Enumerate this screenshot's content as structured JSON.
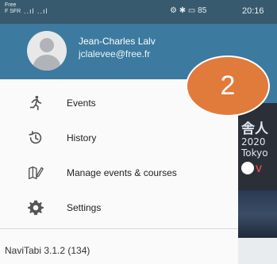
{
  "status_bar": {
    "carrier": "Free\nF SFR",
    "signal": "..ıl ..ıl",
    "icons": "⚙ ✱ ▭",
    "battery": "85",
    "time": "20:16"
  },
  "user": {
    "name": "Jean-Charles Lalv",
    "email": "jclalevee@free.fr"
  },
  "menu": [
    {
      "label": "Events",
      "icon": "runner-icon"
    },
    {
      "label": "History",
      "icon": "history-icon"
    },
    {
      "label": "Manage events & courses",
      "icon": "map-edit-icon"
    },
    {
      "label": "Settings",
      "icon": "gear-icon"
    }
  ],
  "version": "NaviTabi 3.1.2 (134)",
  "badge": "2",
  "background": {
    "text_big": "舎人",
    "text_1": "2020",
    "text_2": "Tokyo",
    "logo_letter": "V"
  },
  "colors": {
    "accent": "#3d7aa0",
    "status_bar": "#385a6e",
    "badge": "#e07b3c"
  }
}
